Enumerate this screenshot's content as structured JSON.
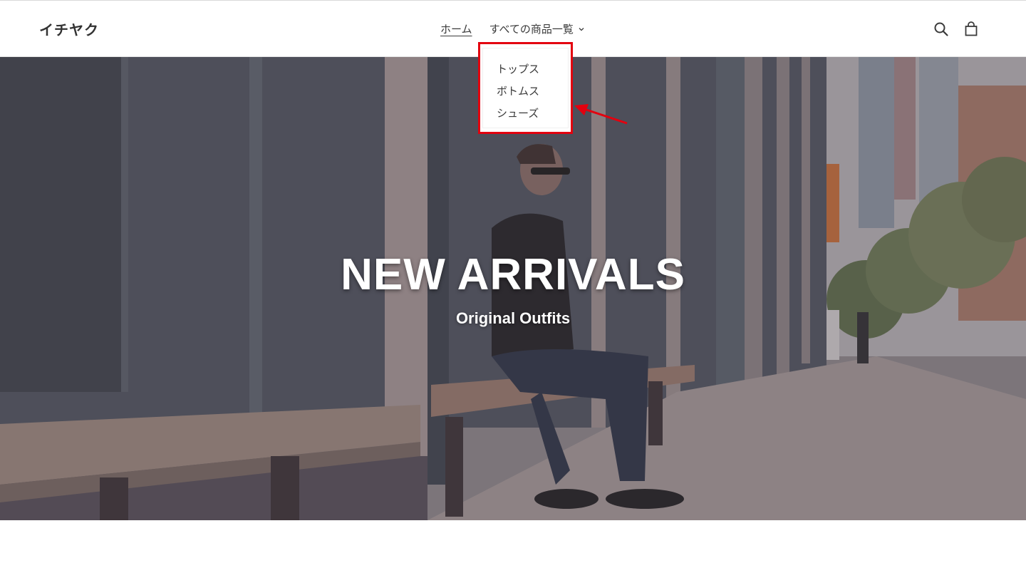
{
  "header": {
    "logo": "イチヤク",
    "nav": {
      "home": "ホーム",
      "all_products": "すべての商品一覧"
    },
    "icons": [
      "search-icon",
      "cart-icon"
    ]
  },
  "dropdown": {
    "items": [
      "トップス",
      "ボトムス",
      "シューズ"
    ]
  },
  "hero": {
    "title": "NEW ARRIVALS",
    "subtitle": "Original Outfits"
  },
  "colors": {
    "highlight": "#e3000f",
    "hero_text": "#ffffff"
  }
}
